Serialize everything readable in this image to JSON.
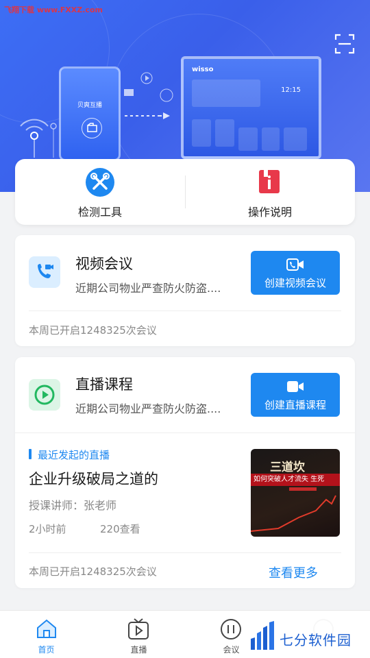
{
  "watermark": "飞翔下载 www.FXXZ.com",
  "hero": {
    "phone_title": "贝爽互播",
    "tv_logo": "wisso",
    "tv_time": "12:15"
  },
  "tools": [
    {
      "label": "检测工具",
      "icon": "tools-icon"
    },
    {
      "label": "操作说明",
      "icon": "manual-icon"
    }
  ],
  "video_meeting": {
    "title": "视频会议",
    "subtitle": "近期公司物业严查防火防盗....",
    "button": "创建视频会议",
    "footer": "本周已开启1248325次会议"
  },
  "live_course": {
    "title": "直播课程",
    "subtitle": "近期公司物业严查防火防盗....",
    "button": "创建直播课程",
    "recent_label": "最近发起的直播",
    "recent_title": "企业升级破局之道的",
    "teacher": "授课讲师：张老师",
    "time_ago": "2小时前",
    "views": "220查看",
    "thumb_text_1": "三道坎",
    "thumb_text_2": "如何突破人才流失 生死",
    "footer": "本周已开启1248325次会议",
    "more": "查看更多"
  },
  "nav": [
    {
      "label": "首页",
      "icon": "home-icon",
      "active": true
    },
    {
      "label": "直播",
      "icon": "tv-icon",
      "active": false
    },
    {
      "label": "会议",
      "icon": "meeting-icon",
      "active": false
    },
    {
      "label": "",
      "icon": "profile-icon",
      "active": false
    }
  ],
  "brand_badge": "七分软件园",
  "colors": {
    "accent": "#1e88f0",
    "hero": "#3d6ef5"
  }
}
